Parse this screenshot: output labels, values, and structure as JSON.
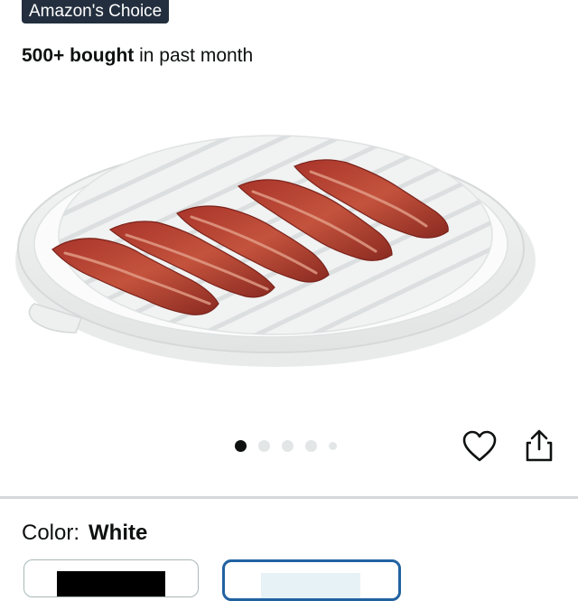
{
  "badge": {
    "label": "Amazon's Choice"
  },
  "social_proof": {
    "strong": "500+ bought",
    "rest": " in past month"
  },
  "image": {
    "subject": "round white plate with bacon strips"
  },
  "carousel": {
    "total": 5,
    "active_index": 1
  },
  "actions": {
    "favorite_icon": "heart-icon",
    "share_icon": "share-icon"
  },
  "color": {
    "label": "Color:",
    "value": "White"
  },
  "swatches": [
    {
      "name": "Black",
      "selected": false,
      "color": "#000000"
    },
    {
      "name": "White",
      "selected": true,
      "color": "#ffffff"
    }
  ],
  "colors": {
    "badge_bg": "#232f3e",
    "selected_border": "#2162a1",
    "divider": "#d5d9d9"
  }
}
